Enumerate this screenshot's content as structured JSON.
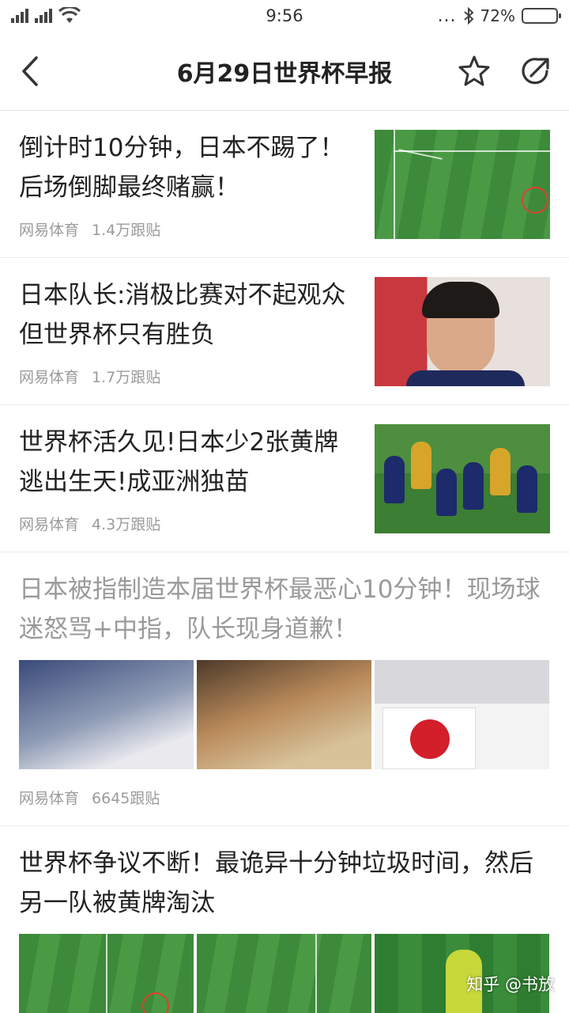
{
  "status_bar": {
    "time": "9:56",
    "more_dots": "...",
    "battery_percent": "72%",
    "battery_level": 0.72
  },
  "header": {
    "title": "6月29日世界杯早报"
  },
  "news": [
    {
      "title": "倒计时10分钟，日本不踢了！后场倒脚最终赌赢！",
      "source": "网易体育",
      "comments": "1.4万跟贴",
      "read": false
    },
    {
      "title": "日本队长:消极比赛对不起观众 但世界杯只有胜负",
      "source": "网易体育",
      "comments": "1.7万跟贴",
      "read": false
    },
    {
      "title": "世界杯活久见!日本少2张黄牌逃出生天!成亚洲独苗",
      "source": "网易体育",
      "comments": "4.3万跟贴",
      "read": false
    },
    {
      "title": "日本被指制造本届世界杯最恶心10分钟！现场球迷怒骂+中指，队长现身道歉！",
      "source": "网易体育",
      "comments": "6645跟贴",
      "read": true
    },
    {
      "title": "世界杯争议不断！最诡异十分钟垃圾时间，然后另一队被黄牌淘汰",
      "read": false
    }
  ],
  "watermark": "知乎 @书放",
  "colors": {
    "text": "#222222",
    "meta": "#9b9b9b",
    "read_title": "#9a9a9a",
    "divider": "#ececec"
  },
  "icons": [
    "cellular-signal-icon",
    "wifi-icon",
    "bluetooth-icon",
    "battery-icon",
    "back-arrow-icon",
    "star-icon",
    "share-icon"
  ]
}
